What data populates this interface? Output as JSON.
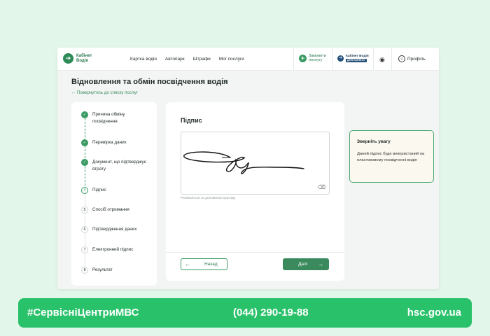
{
  "header": {
    "logo_mark": "➔",
    "logo_text": "Кабінет Водія",
    "nav": [
      "Картка водія",
      "Автопарк",
      "Штрафи",
      "Мої послуги"
    ],
    "apply_label": "Замовити послугу",
    "business_label": "Кабінет Водія",
    "business_badge": "ДЛЯ БІЗНЕСУ",
    "profile_label": "Профіль",
    "icons": [
      "plus-icon",
      "eye-icon",
      "profile-icon"
    ]
  },
  "page": {
    "title": "Відновлення та обмін посвідчення водія",
    "back_link": "← Повернутись до списку послуг"
  },
  "steps": [
    {
      "num": "✓",
      "label": "Причина обміну посвідчення",
      "state": "done"
    },
    {
      "num": "✓",
      "label": "Перевірка даних",
      "state": "done"
    },
    {
      "num": "✓",
      "label": "Документ, що підтверджує втрату",
      "state": "done"
    },
    {
      "num": "4",
      "label": "Підпис",
      "state": "current"
    },
    {
      "num": "5",
      "label": "Спосіб отримання",
      "state": "todo"
    },
    {
      "num": "6",
      "label": "Підтвердження даних",
      "state": "todo"
    },
    {
      "num": "7",
      "label": "Електронний підпис",
      "state": "todo"
    },
    {
      "num": "8",
      "label": "Результат",
      "state": "todo"
    }
  ],
  "signature": {
    "title": "Підпис",
    "hint": "Розпишіться за допомогою курсору",
    "back_label": "Назад",
    "next_label": "Далі"
  },
  "notice": {
    "title": "Зверніть увагу",
    "text": "Даний підпис буде використаний на пластиковому посвідченні водія"
  },
  "footer": {
    "hashtag": "#СервісніЦентриМВС",
    "phone": "(044) 290-19-88",
    "site": "hsc.gov.ua"
  },
  "colors": {
    "accent": "#3a9a63",
    "footer": "#29c26a",
    "background": "#e3f6ea"
  }
}
